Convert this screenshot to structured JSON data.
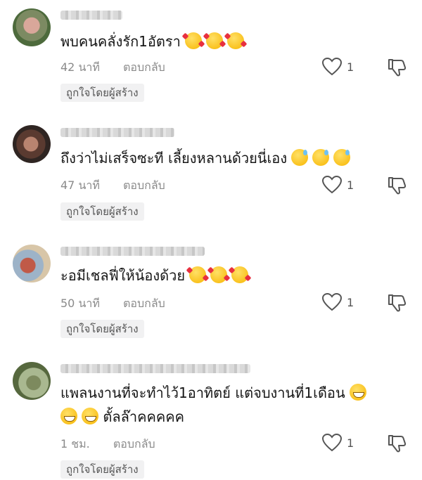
{
  "comments": [
    {
      "text": "พบคนคลั่งรัก1อัตรา",
      "emojis": [
        "smiling-face-with-hearts",
        "smiling-face-with-hearts",
        "smiling-face-with-hearts"
      ],
      "time": "42 นาที",
      "reply_label": "ตอบกลับ",
      "likes": "1",
      "badge": "ถูกใจโดยผู้สร้าง"
    },
    {
      "text": "ถึงว่าไม่เสร็จซะที เลี้ยงหลานด้วยนี่เอง",
      "emojis": [
        "grinning-face-with-sweat",
        "grinning-face-with-sweat",
        "grinning-face-with-sweat"
      ],
      "time": "47 นาที",
      "reply_label": "ตอบกลับ",
      "likes": "1",
      "badge": "ถูกใจโดยผู้สร้าง"
    },
    {
      "text": "ะอมีเชลฟี่ให้น้องด้วย",
      "emojis": [
        "smiling-face-with-hearts",
        "smiling-face-with-hearts",
        "smiling-face-with-hearts"
      ],
      "time": "50 นาที",
      "reply_label": "ตอบกลับ",
      "likes": "1",
      "badge": "ถูกใจโดยผู้สร้าง"
    },
    {
      "text_line1": "แพลนงานที่จะทำไว้1อาทิตย์ แต่จบงานที่1เดือน",
      "text_line2": "ตั้ลล๊าคคคคค",
      "emojis": [
        "beaming-face",
        "beaming-face",
        "beaming-face"
      ],
      "time": "1 ชม.",
      "reply_label": "ตอบกลับ",
      "likes": "1",
      "badge": "ถูกใจโดยผู้สร้าง"
    }
  ]
}
